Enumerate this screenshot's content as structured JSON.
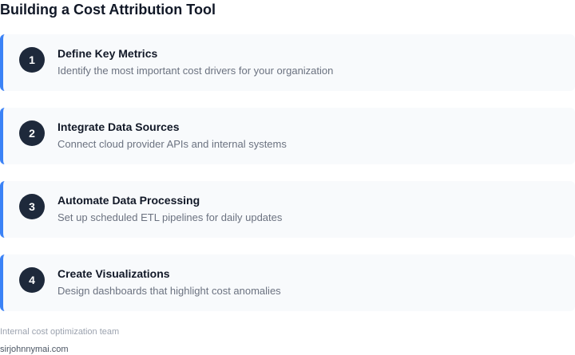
{
  "page": {
    "title": "Building a Cost Attribution Tool"
  },
  "steps": [
    {
      "number": "1",
      "title": "Define Key Metrics",
      "description": "Identify the most important cost drivers for your organization"
    },
    {
      "number": "2",
      "title": "Integrate Data Sources",
      "description": "Connect cloud provider APIs and internal systems"
    },
    {
      "number": "3",
      "title": "Automate Data Processing",
      "description": "Set up scheduled ETL pipelines for daily updates"
    },
    {
      "number": "4",
      "title": "Create Visualizations",
      "description": "Design dashboards that highlight cost anomalies"
    }
  ],
  "footer": {
    "note": "Internal cost optimization team",
    "site": "sirjohnnymai.com"
  },
  "colors": {
    "accent": "#3b82f6",
    "badge": "#1e293b",
    "card_background": "#f8fafc"
  }
}
